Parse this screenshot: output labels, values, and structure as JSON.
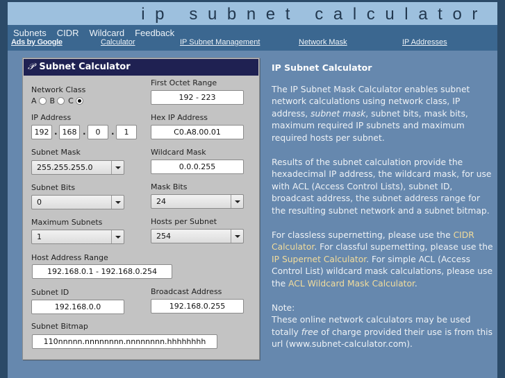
{
  "banner": {
    "title": "ip subnet calculator"
  },
  "nav": {
    "links": [
      "Subnets",
      "CIDR",
      "Wildcard",
      "Feedback"
    ]
  },
  "ads": {
    "label": "Ads by Google",
    "links": [
      "Calculator",
      "IP Subnet Management",
      "Network Mask",
      "IP Addresses"
    ]
  },
  "calculator": {
    "title": "Subnet Calculator",
    "logo_glyph": "𝒫",
    "network_class": {
      "label": "Network Class",
      "options": [
        "A",
        "B",
        "C"
      ],
      "selected": "C"
    },
    "first_octet_range": {
      "label": "First Octet Range",
      "value": "192 - 223"
    },
    "ip_address": {
      "label": "IP Address",
      "octets": [
        "192",
        "168",
        "0",
        "1"
      ],
      "separator": "."
    },
    "hex_ip": {
      "label": "Hex IP Address",
      "value": "C0.A8.00.01"
    },
    "subnet_mask": {
      "label": "Subnet Mask",
      "value": "255.255.255.0"
    },
    "wildcard_mask": {
      "label": "Wildcard Mask",
      "value": "0.0.0.255"
    },
    "subnet_bits": {
      "label": "Subnet Bits",
      "value": "0"
    },
    "mask_bits": {
      "label": "Mask Bits",
      "value": "24"
    },
    "max_subnets": {
      "label": "Maximum Subnets",
      "value": "1"
    },
    "hosts_per_subnet": {
      "label": "Hosts per Subnet",
      "value": "254"
    },
    "host_range": {
      "label": "Host Address Range",
      "value": "192.168.0.1 - 192.168.0.254"
    },
    "subnet_id": {
      "label": "Subnet ID",
      "value": "192.168.0.0"
    },
    "broadcast": {
      "label": "Broadcast Address",
      "value": "192.168.0.255"
    },
    "bitmap": {
      "label": "Subnet Bitmap",
      "value": "110nnnnn.nnnnnnnn.nnnnnnnn.hhhhhhhh"
    }
  },
  "description": {
    "heading": "IP Subnet Calculator",
    "p1_pre": "The IP Subnet Mask Calculator enables subnet network calculations using network class, IP address, ",
    "p1_em": "subnet mask",
    "p1_post": ", subnet bits, mask bits, maximum required IP subnets and maximum required hosts per subnet.",
    "p2": "Results of the subnet calculation provide the hexadecimal IP address, the wildcard mask, for use with ACL (Access Control Lists), subnet ID, broadcast address, the subnet address range for the resulting subnet network and a subnet bitmap.",
    "p3_a": "For classless supernetting, please use the ",
    "p3_link1": "CIDR Calculator",
    "p3_b": ". For classful supernetting, please use the ",
    "p3_link2": "IP Supernet Calculator",
    "p3_c": ". For simple ACL (Access Control List) wildcard mask calculations, please use the ",
    "p3_link3": "ACL Wildcard Mask Calculator",
    "p3_d": ".",
    "note_label": "Note:",
    "note_pre": "These online network calculators may be used totally ",
    "note_em": "free",
    "note_post": " of charge provided their use is from this url (www.subnet-calculator.com)."
  },
  "colors": {
    "page_bg": "#6688ae",
    "banner_bg": "#9dc0de",
    "nav_bg": "#3b6790",
    "panel_header_bg": "#1f2152",
    "link_accent": "#f2dc9c"
  }
}
